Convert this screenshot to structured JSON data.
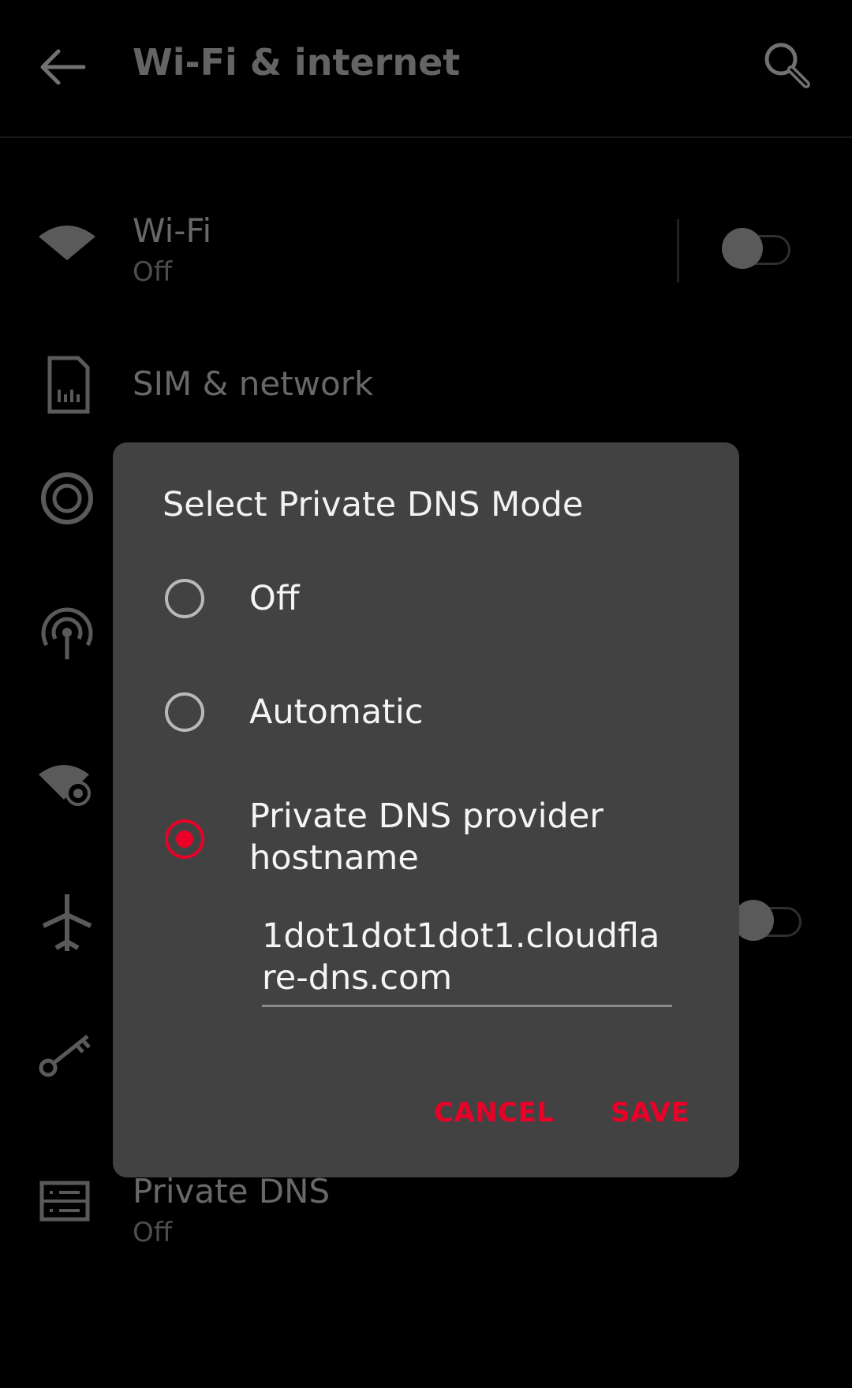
{
  "appbar": {
    "title": "Wi-Fi & internet",
    "back_icon": "arrow-back-icon",
    "search_icon": "search-icon"
  },
  "settings": {
    "wifi": {
      "title": "Wi-Fi",
      "subtitle": "Off",
      "icon": "wifi-icon",
      "toggle_on": false
    },
    "sim": {
      "title": "SIM & network",
      "icon": "sim-card-icon"
    },
    "data_usage": {
      "icon": "data-usage-icon"
    },
    "hotspot": {
      "icon": "hotspot-icon"
    },
    "data_saver": {
      "icon": "data-saver-icon"
    },
    "airplane": {
      "icon": "airplane-icon",
      "toggle_on": false
    },
    "vpn": {
      "icon": "vpn-key-icon"
    },
    "private_dns": {
      "title": "Private DNS",
      "subtitle": "Off",
      "icon": "dns-icon"
    }
  },
  "dialog": {
    "title": "Select Private DNS Mode",
    "options": [
      {
        "label": "Off",
        "selected": false
      },
      {
        "label": "Automatic",
        "selected": false
      },
      {
        "label": "Private DNS provider hostname",
        "selected": true
      }
    ],
    "hostname_value": "1dot1dot1dot1.cloudflare-dns.com",
    "cancel_label": "CANCEL",
    "save_label": "SAVE"
  },
  "colors": {
    "accent": "#eb0028",
    "dialog_bg": "#424242",
    "background": "#000000"
  }
}
